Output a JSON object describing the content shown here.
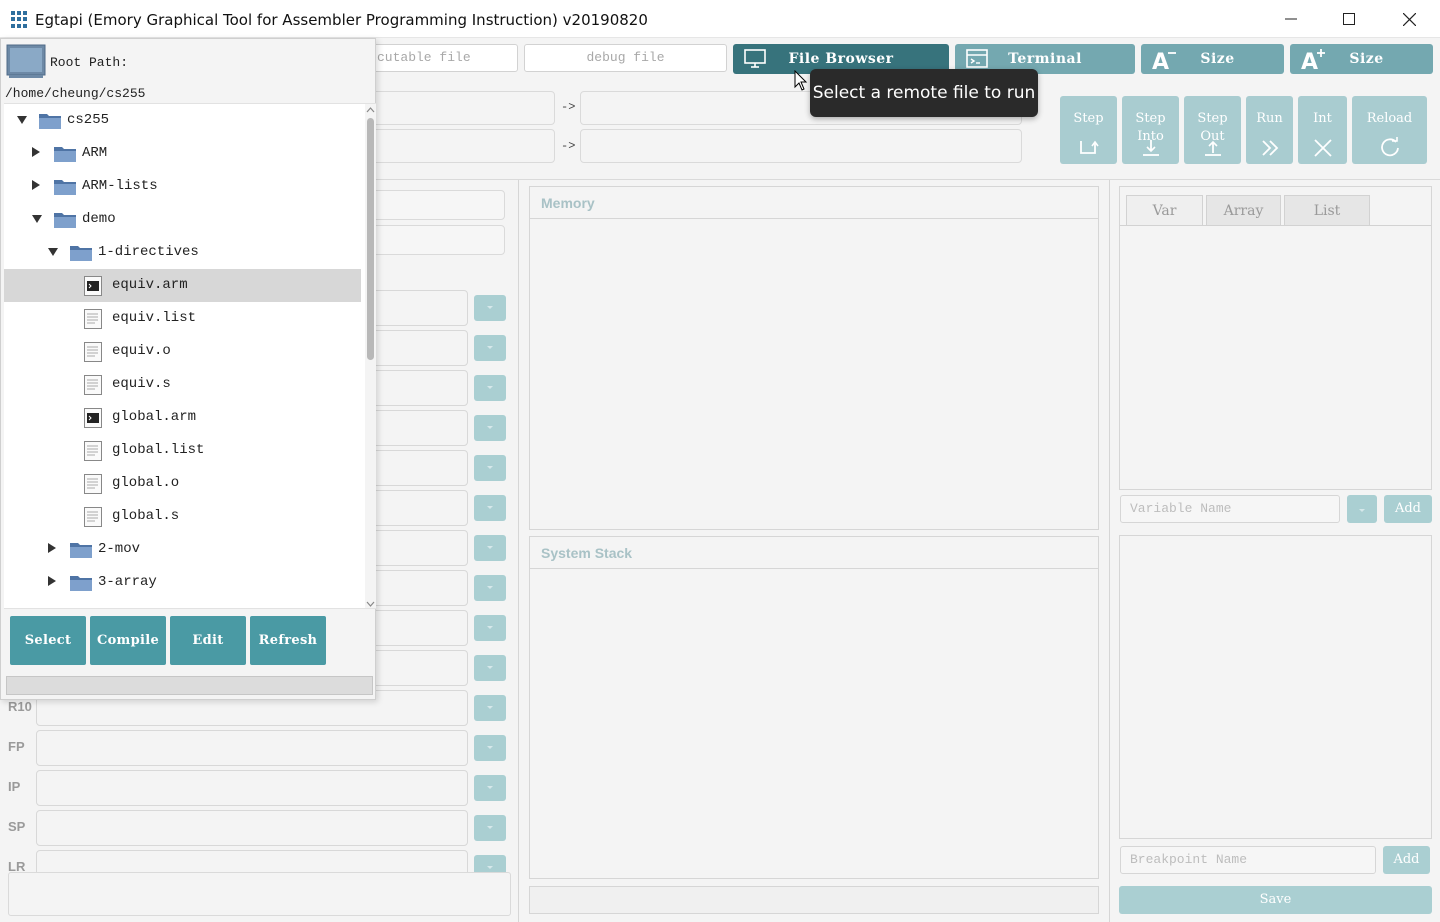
{
  "window": {
    "title": "Egtapi (Emory Graphical Tool for Assembler Programming Instruction) v20190820",
    "controls": [
      "minimize",
      "maximize",
      "close"
    ]
  },
  "toolbar": {
    "executable_placeholder": "executable file",
    "executable_visible": "cutable file",
    "debug_placeholder": "debug file",
    "file_browser_label": "File Browser",
    "terminal_label": "Terminal",
    "size_decrease_label": "Size",
    "size_increase_label": "Size"
  },
  "tooltip": "Select a remote file to run",
  "debug_buttons": [
    {
      "line1": "Step",
      "line2": ""
    },
    {
      "line1": "Step",
      "line2": "Into"
    },
    {
      "line1": "Step",
      "line2": "Out"
    },
    {
      "line1": "Run",
      "line2": ""
    },
    {
      "line1": "Int",
      "line2": ""
    },
    {
      "line1": "Reload",
      "line2": ""
    }
  ],
  "arrows": [
    "->",
    "->"
  ],
  "registers": [
    "R10",
    "FP",
    "IP",
    "SP",
    "LR"
  ],
  "memory_title": "Memory",
  "stack_title": "System Stack",
  "right_panel": {
    "tabs": [
      "Var",
      "Array",
      "List"
    ],
    "variable_placeholder": "Variable Name",
    "add_label": "Add",
    "breakpoint_placeholder": "Breakpoint Name",
    "add_bp_label": "Add",
    "save_label": "Save"
  },
  "file_browser": {
    "root_label": "Root Path:",
    "root_path": "/home/cheung/cs255",
    "tree": [
      {
        "label": "cs255",
        "type": "folder",
        "expanded": true,
        "level": 0
      },
      {
        "label": "ARM",
        "type": "folder",
        "expanded": false,
        "level": 1
      },
      {
        "label": "ARM-lists",
        "type": "folder",
        "expanded": false,
        "level": 1
      },
      {
        "label": "demo",
        "type": "folder",
        "expanded": true,
        "level": 1
      },
      {
        "label": "1-directives",
        "type": "folder",
        "expanded": true,
        "level": 2
      },
      {
        "label": "equiv.arm",
        "type": "exec",
        "level": 3,
        "selected": true
      },
      {
        "label": "equiv.list",
        "type": "file",
        "level": 3
      },
      {
        "label": "equiv.o",
        "type": "file",
        "level": 3
      },
      {
        "label": "equiv.s",
        "type": "file",
        "level": 3
      },
      {
        "label": "global.arm",
        "type": "exec",
        "level": 3
      },
      {
        "label": "global.list",
        "type": "file",
        "level": 3
      },
      {
        "label": "global.o",
        "type": "file",
        "level": 3
      },
      {
        "label": "global.s",
        "type": "file",
        "level": 3
      },
      {
        "label": "2-mov",
        "type": "folder",
        "expanded": false,
        "level": 2
      },
      {
        "label": "3-array",
        "type": "folder",
        "expanded": false,
        "level": 2
      }
    ],
    "buttons": {
      "select": "Select",
      "compile": "Compile",
      "edit": "Edit",
      "refresh": "Refresh"
    }
  },
  "colors": {
    "teal": "#74a8b0",
    "teal_active": "#37737c",
    "teal_light": "#a9ccd0",
    "fb_button": "#4a9aa4"
  }
}
